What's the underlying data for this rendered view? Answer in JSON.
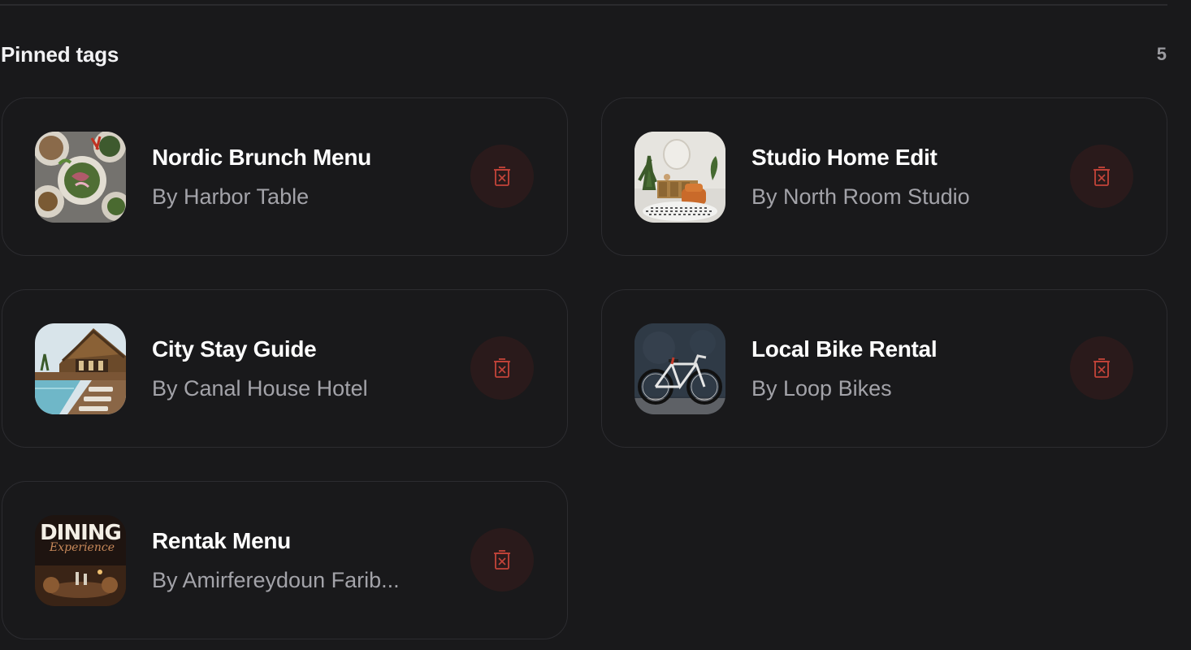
{
  "section": {
    "title": "Pinned tags",
    "count": "5"
  },
  "colors": {
    "background": "#19191b",
    "card_border": "#2c2c30",
    "delete_bg": "#2a1a1b",
    "delete_icon": "#c4443a",
    "subtitle": "#a3a3a9"
  },
  "tags": [
    {
      "title": "Nordic Brunch Menu",
      "subtitle": "By Harbor Table",
      "thumb_icon": "food-plates-thumbnail",
      "delete_icon": "trash-icon"
    },
    {
      "title": "Studio Home Edit",
      "subtitle": "By North Room Studio",
      "thumb_icon": "living-room-thumbnail",
      "delete_icon": "trash-icon"
    },
    {
      "title": "City Stay Guide",
      "subtitle": "By Canal House Hotel",
      "thumb_icon": "resort-pool-thumbnail",
      "delete_icon": "trash-icon"
    },
    {
      "title": "Local Bike Rental",
      "subtitle": "By Loop Bikes",
      "thumb_icon": "bicycle-thumbnail",
      "delete_icon": "trash-icon"
    },
    {
      "title": "Rentak Menu",
      "subtitle": "By Amirfereydoun Farib...",
      "thumb_icon": "dining-poster-thumbnail",
      "delete_icon": "trash-icon",
      "thumb_text": {
        "line1": "DINING",
        "line2": "Experience"
      }
    }
  ]
}
